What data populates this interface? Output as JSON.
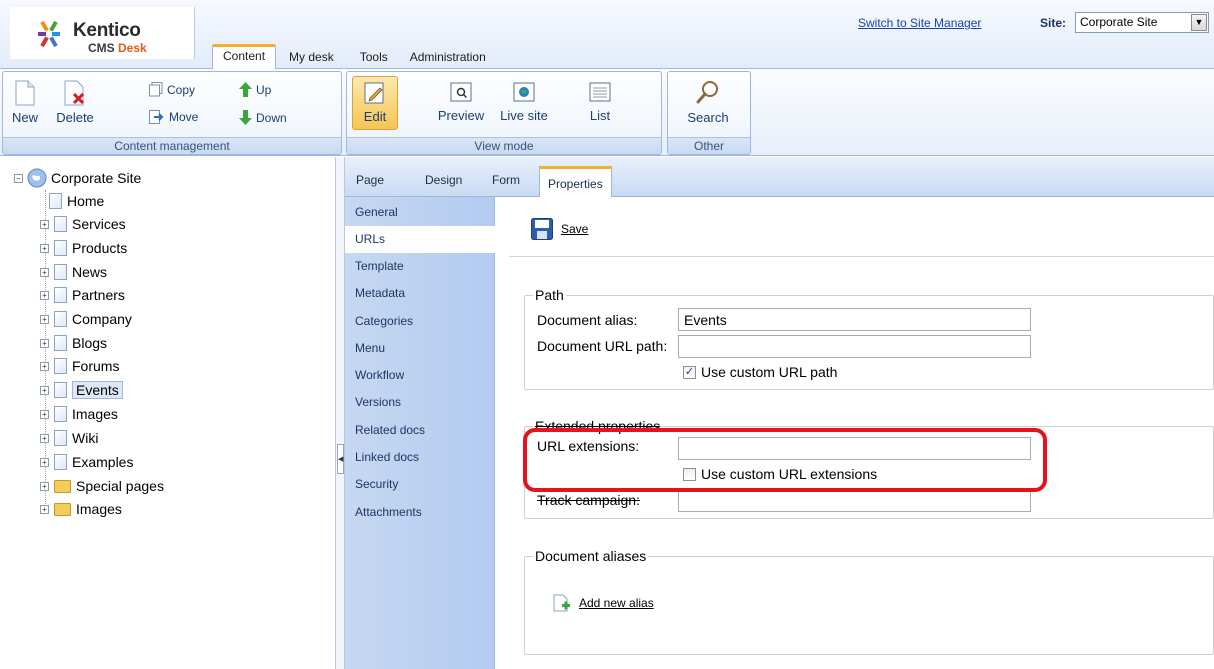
{
  "header": {
    "logo_name": "Kentico",
    "logo_sub": "CMS",
    "logo_sub_accent": "Desk",
    "tabs": [
      {
        "label": "Content",
        "active": true
      },
      {
        "label": "My desk",
        "active": false
      },
      {
        "label": "Tools",
        "active": false
      },
      {
        "label": "Administration",
        "active": false
      }
    ],
    "switch_link": "Switch to Site Manager",
    "site_label": "Site:",
    "site_value": "Corporate Site"
  },
  "toolbar": {
    "content_management": {
      "label": "Content management",
      "new": "New",
      "delete": "Delete",
      "copy": "Copy",
      "move": "Move",
      "up": "Up",
      "down": "Down"
    },
    "view_mode": {
      "label": "View mode",
      "edit": "Edit",
      "preview": "Preview",
      "live_site": "Live site",
      "list": "List"
    },
    "other": {
      "label": "Other",
      "search": "Search"
    }
  },
  "tree": {
    "root": "Corporate Site",
    "items": [
      {
        "label": "Home",
        "expandable": false,
        "type": "doc"
      },
      {
        "label": "Services",
        "expandable": true,
        "type": "doc"
      },
      {
        "label": "Products",
        "expandable": true,
        "type": "doc"
      },
      {
        "label": "News",
        "expandable": true,
        "type": "doc"
      },
      {
        "label": "Partners",
        "expandable": true,
        "type": "doc"
      },
      {
        "label": "Company",
        "expandable": true,
        "type": "doc"
      },
      {
        "label": "Blogs",
        "expandable": true,
        "type": "doc"
      },
      {
        "label": "Forums",
        "expandable": true,
        "type": "doc"
      },
      {
        "label": "Events",
        "expandable": true,
        "type": "doc",
        "selected": true
      },
      {
        "label": "Images",
        "expandable": true,
        "type": "doc"
      },
      {
        "label": "Wiki",
        "expandable": true,
        "type": "doc"
      },
      {
        "label": "Examples",
        "expandable": true,
        "type": "doc"
      },
      {
        "label": "Special pages",
        "expandable": true,
        "type": "folder"
      },
      {
        "label": "Images",
        "expandable": true,
        "type": "folder"
      }
    ]
  },
  "prop_tabs": [
    {
      "label": "Page",
      "active": false
    },
    {
      "label": "Design",
      "active": false
    },
    {
      "label": "Form",
      "active": false
    },
    {
      "label": "Properties",
      "active": true
    }
  ],
  "vmenu": [
    {
      "label": "General",
      "active": false
    },
    {
      "label": "URLs",
      "active": true
    },
    {
      "label": "Template",
      "active": false
    },
    {
      "label": "Metadata",
      "active": false
    },
    {
      "label": "Categories",
      "active": false
    },
    {
      "label": "Menu",
      "active": false
    },
    {
      "label": "Workflow",
      "active": false
    },
    {
      "label": "Versions",
      "active": false
    },
    {
      "label": "Related docs",
      "active": false
    },
    {
      "label": "Linked docs",
      "active": false
    },
    {
      "label": "Security",
      "active": false
    },
    {
      "label": "Attachments",
      "active": false
    }
  ],
  "content": {
    "save": "Save",
    "path": {
      "legend": "Path",
      "alias_label": "Document alias:",
      "alias_value": "Events",
      "url_path_label": "Document URL path:",
      "url_path_value": "",
      "custom_url_label": "Use custom URL path",
      "custom_url_checked": true
    },
    "extended": {
      "legend": "Extended properties",
      "url_ext_label": "URL extensions:",
      "url_ext_value": "",
      "custom_ext_label": "Use custom URL extensions",
      "custom_ext_checked": false,
      "track_label": "Track campaign:",
      "track_value": ""
    },
    "aliases": {
      "legend": "Document aliases",
      "add_alias": "Add new alias"
    }
  },
  "colors": {
    "accent_tab": "#f2b12b",
    "highlight": "#e3141b",
    "brand_orange": "#e25b1a"
  }
}
